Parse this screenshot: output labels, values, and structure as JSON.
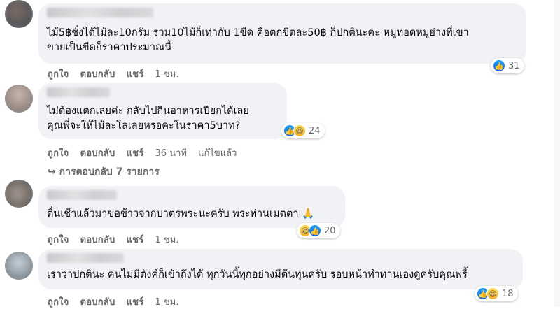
{
  "comments": [
    {
      "text_line1": "ไม้5฿ชั่งได้ไม้ละ10กรัม รวม10ไม้ก็เท่ากับ 1ขีด คือตกขีดละ50฿ ก็ปกตินะคะ หมูทอดหมูย่างที่เขา",
      "text_line2": "ขายเป็นขีดก็ราคาประมาณนี้",
      "like_label": "ถูกใจ",
      "reply_label": "ตอบกลับ",
      "share_label": "แชร์",
      "time": "1 ชม.",
      "edited": "",
      "reaction_icons": [
        "like-icon"
      ],
      "reaction_count": "31"
    },
    {
      "text_line1": "ไม่ต้องแตกเลยค่ะ กลับไปกินอาหารเปียกได้เลย",
      "text_line2": "คุณพี่จะให้ไม้ละโลเลยหรอคะในราคา5บาท?",
      "like_label": "ถูกใจ",
      "reply_label": "ตอบกลับ",
      "share_label": "แชร์",
      "time": "36 นาที",
      "edited": "แก้ไขแล้ว",
      "reaction_icons": [
        "like-icon",
        "haha-icon"
      ],
      "reaction_count": "24",
      "replies_label": "การตอบกลับ 7 รายการ"
    },
    {
      "text_line1": "ตื่นเช้าแล้วมาขอข้าวจากบาตรพระนะครับ พระท่านเมตตา 🙏",
      "text_line2": "",
      "like_label": "ถูกใจ",
      "reply_label": "ตอบกลับ",
      "share_label": "แชร์",
      "time": "1 ชม.",
      "edited": "",
      "reaction_icons": [
        "haha-icon",
        "like-icon"
      ],
      "reaction_count": "20"
    },
    {
      "text_line1": "เราว่าปกตินะ คนไม่มีตังค์ก็เข้าถึงได้ ทุกวันนี้ทุกอย่างมีต้นทุนครับ รอบหน้าทำทานเองดูครับคุณพรี้",
      "text_line2": "",
      "like_label": "ถูกใจ",
      "reply_label": "ตอบกลับ",
      "share_label": "แชร์",
      "time": "1 ชม.",
      "edited": "",
      "reaction_icons": [
        "like-icon",
        "haha-icon"
      ],
      "reaction_count": "18"
    }
  ],
  "colors": {
    "bubble": "#f0f2f5",
    "meta": "#65676b",
    "like": "#0866ff",
    "haha": "#f7b125"
  }
}
